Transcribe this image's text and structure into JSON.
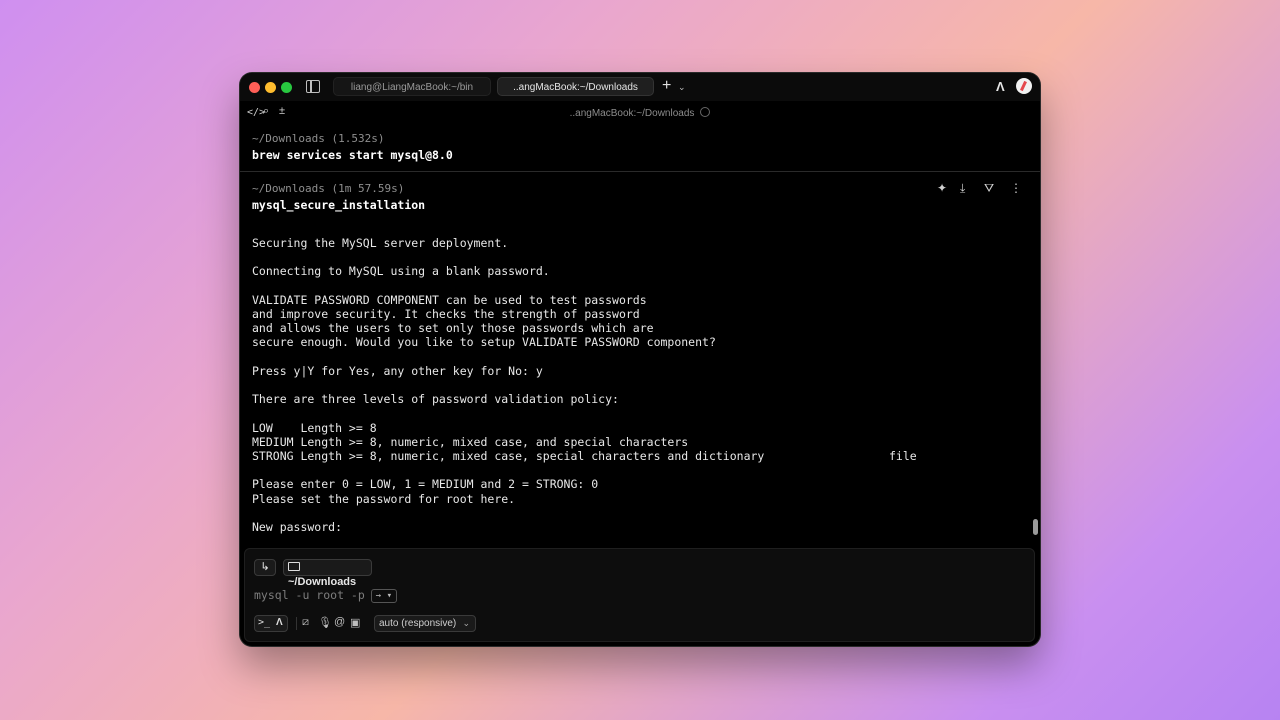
{
  "window": {
    "tabs": [
      {
        "label": "liang@LiangMacBook:~/bin"
      },
      {
        "label": "..angMacBook:~/Downloads"
      }
    ],
    "toolbar_title": "..angMacBook:~/Downloads"
  },
  "blocks": [
    {
      "meta": "~/Downloads  (1.532s)",
      "command": "brew services start mysql@8.0"
    },
    {
      "meta": "~/Downloads  (1m 57.59s)",
      "command": "mysql_secure_installation",
      "output": "Securing the MySQL server deployment.\n\nConnecting to MySQL using a blank password.\n\nVALIDATE PASSWORD COMPONENT can be used to test passwords\nand improve security. It checks the strength of password\nand allows the users to set only those passwords which are\nsecure enough. Would you like to setup VALIDATE PASSWORD component?\n\nPress y|Y for Yes, any other key for No: y\n\nThere are three levels of password validation policy:\n\nLOW    Length >= 8\nMEDIUM Length >= 8, numeric, mixed case, and special characters\nSTRONG Length >= 8, numeric, mixed case, special characters and dictionary                  file\n\nPlease enter 0 = LOW, 1 = MEDIUM and 2 = STRONG: 0\nPlease set the password for root here.\n\nNew password:"
    }
  ],
  "input": {
    "current_dir": "~/Downloads",
    "value": "mysql -u root -p",
    "model": "auto (responsive)"
  },
  "icons": {
    "traffic_lights": [
      "#ff5f57",
      "#febc2e",
      "#28c840"
    ],
    "block_actions": [
      "sparkle-icon",
      "download-icon",
      "filter-icon",
      "more-icon"
    ]
  }
}
